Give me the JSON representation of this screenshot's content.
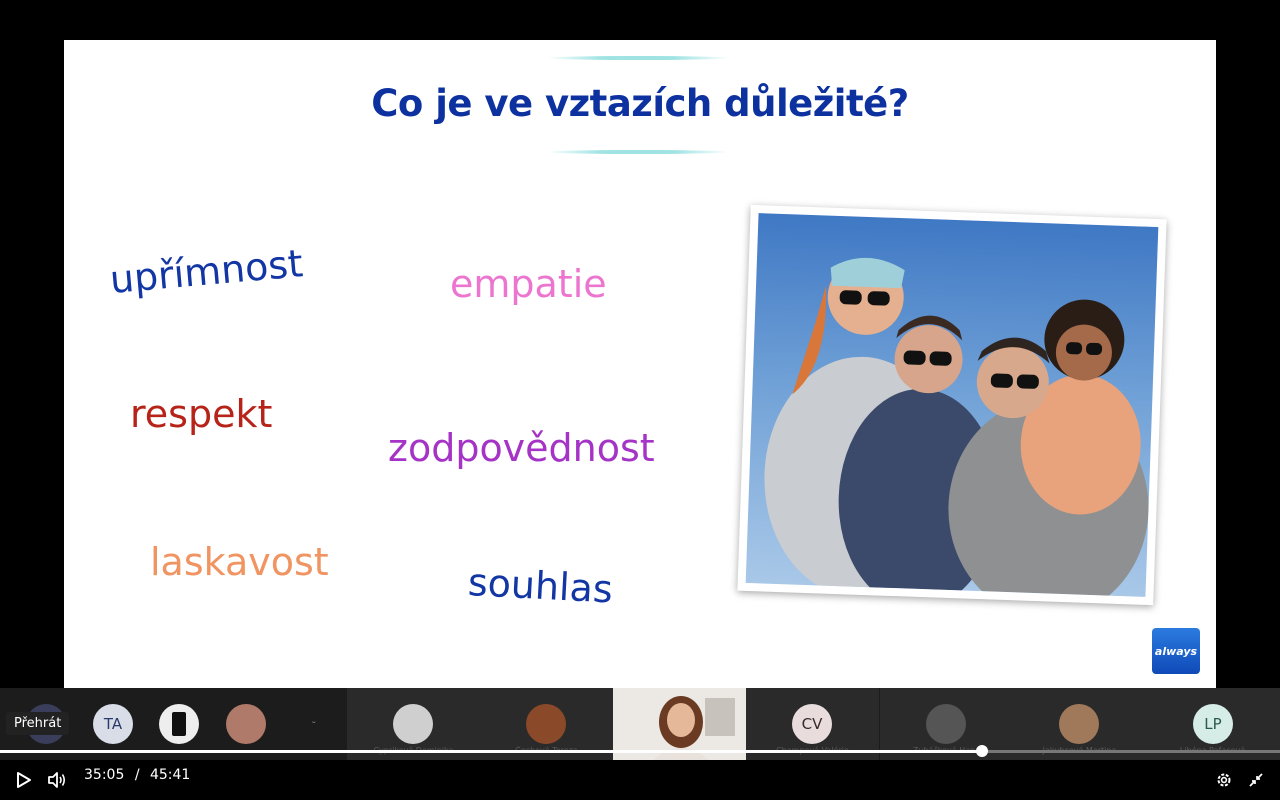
{
  "slide": {
    "title": "Co je ve vztazích důležité?",
    "words": [
      "upřímnost",
      "empatie",
      "respekt",
      "zodpovědnost",
      "laskavost",
      "souhlas"
    ],
    "logo_text": "always",
    "colors": {
      "title": "#0d32a0",
      "upfimnost": "#1236a4",
      "empatie": "#ec76cf",
      "respekt": "#b72318",
      "zodpovednost": "#a534c6",
      "laskavost": "#f09462",
      "souhlas": "#1236a4"
    }
  },
  "participants": [
    {
      "initials": "",
      "name": ""
    },
    {
      "initials": "TA",
      "name": ""
    },
    {
      "initials": "",
      "name": ""
    },
    {
      "initials": "",
      "name": ""
    },
    {
      "initials": "",
      "name": ""
    },
    {
      "initials": "",
      "name": "Cypriková Dominika"
    },
    {
      "initials": "",
      "name": "Čechová Tereza"
    },
    {
      "initials": "",
      "name": ""
    },
    {
      "initials": "CV",
      "name": "Champová Valérie"
    },
    {
      "initials": "",
      "name": "Zubáčková Hana"
    },
    {
      "initials": "",
      "name": "Jakubcová Martina"
    },
    {
      "initials": "LP",
      "name": "Libéna Paťasová"
    }
  ],
  "player": {
    "tooltip": "Přehrát",
    "current_time": "35:05",
    "separator": "/",
    "duration": "45:41",
    "progress_fraction": 0.7675
  }
}
